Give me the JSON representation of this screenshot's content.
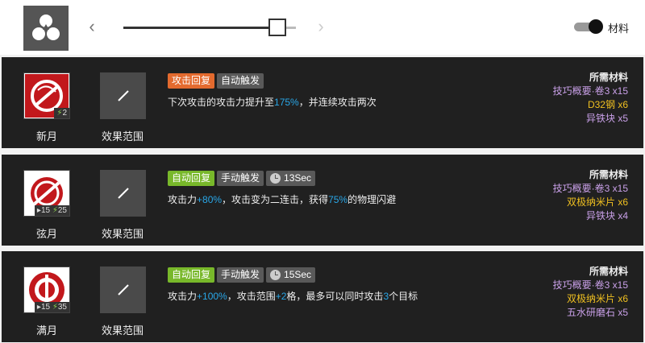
{
  "header": {
    "toggle_label": "材料",
    "slider_value_fraction": 0.94
  },
  "skills": [
    {
      "name": "新月",
      "range_label": "效果范围",
      "badge": {
        "sp": "2"
      },
      "tags": [
        {
          "label": "攻击回复",
          "color": "orange"
        },
        {
          "label": "自动触发",
          "color": "gray"
        }
      ],
      "desc_parts": [
        "下次攻击的攻击力提升至",
        "175%",
        "，并连续攻击两次"
      ],
      "materials": {
        "title": "所需材料",
        "items": [
          {
            "text": "技巧概要·卷3 x15",
            "color": "purple"
          },
          {
            "text": "D32钢 x6",
            "color": "gold"
          },
          {
            "text": "异铁块 x5",
            "color": "purple"
          }
        ]
      }
    },
    {
      "name": "弦月",
      "range_label": "效果范围",
      "badge": {
        "init": "15",
        "sp": "25"
      },
      "tags": [
        {
          "label": "自动回复",
          "color": "green"
        },
        {
          "label": "手动触发",
          "color": "gray"
        }
      ],
      "timer": "13Sec",
      "desc_parts": [
        "攻击力",
        "+80%",
        "，攻击变为二连击，获得",
        "75%",
        "的物理闪避"
      ],
      "materials": {
        "title": "所需材料",
        "items": [
          {
            "text": "技巧概要·卷3 x15",
            "color": "purple"
          },
          {
            "text": "双极纳米片 x6",
            "color": "gold"
          },
          {
            "text": "异铁块 x4",
            "color": "purple"
          }
        ]
      }
    },
    {
      "name": "满月",
      "range_label": "效果范围",
      "badge": {
        "init": "15",
        "sp": "35"
      },
      "tags": [
        {
          "label": "自动回复",
          "color": "green"
        },
        {
          "label": "手动触发",
          "color": "gray"
        }
      ],
      "timer": "15Sec",
      "desc_parts": [
        "攻击力",
        "+100%",
        "，攻击范围",
        "+2",
        "格，最多可以同时攻击",
        "3",
        "个目标"
      ],
      "materials": {
        "title": "所需材料",
        "items": [
          {
            "text": "技巧概要·卷3 x15",
            "color": "purple"
          },
          {
            "text": "双极纳米片 x6",
            "color": "gold"
          },
          {
            "text": "五水研磨石 x5",
            "color": "purple"
          }
        ]
      }
    }
  ]
}
